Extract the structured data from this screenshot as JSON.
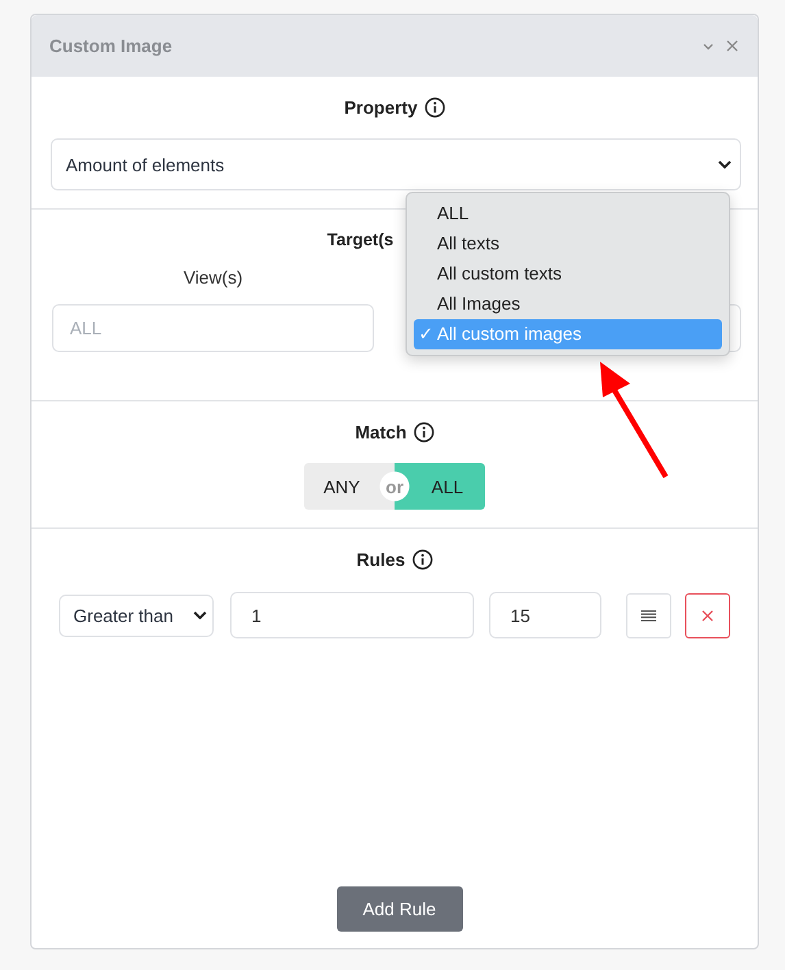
{
  "window": {
    "title": "Custom Image"
  },
  "property": {
    "label": "Property",
    "value": "Amount of elements"
  },
  "targets": {
    "label": "Target(s",
    "check_mark": "✓",
    "views_label": "View(s)",
    "views_placeholder": "ALL",
    "dropdown": [
      {
        "label": "ALL",
        "selected": false
      },
      {
        "label": "All texts",
        "selected": false
      },
      {
        "label": "All custom texts",
        "selected": false
      },
      {
        "label": "All Images",
        "selected": false
      },
      {
        "label": "All custom images",
        "selected": true
      }
    ]
  },
  "match": {
    "label": "Match",
    "separator": "or",
    "options": [
      {
        "label": "ANY",
        "selected": false
      },
      {
        "label": "ALL",
        "selected": true
      }
    ]
  },
  "rules": {
    "label": "Rules",
    "rows": [
      {
        "operator": "Greater than",
        "value": "1",
        "limit": "15"
      }
    ],
    "add_button": "Add Rule"
  }
}
